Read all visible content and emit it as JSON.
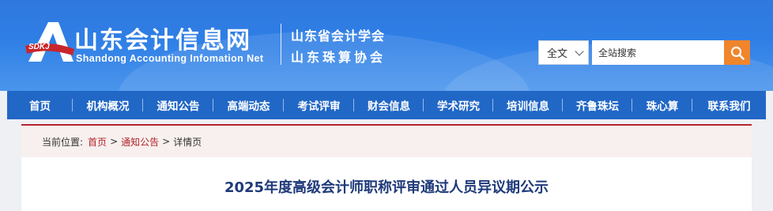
{
  "header": {
    "site_name_cn": "山东会计信息网",
    "site_name_en": "Shandong Accounting Infomation Net",
    "logo_badge": "SDKJ",
    "association_1": "山东省会计学会",
    "association_2": "山东珠算协会",
    "colors": {
      "background": "#2f78de",
      "accent": "#f0852b"
    }
  },
  "search": {
    "scope_selected": "全文",
    "placeholder": "全站搜索",
    "button_icon": "search-icon"
  },
  "nav": {
    "items": [
      {
        "label": "首页"
      },
      {
        "label": "机构概况"
      },
      {
        "label": "通知公告"
      },
      {
        "label": "高端动态"
      },
      {
        "label": "考试评审"
      },
      {
        "label": "财会信息"
      },
      {
        "label": "学术研究"
      },
      {
        "label": "培训信息"
      },
      {
        "label": "齐鲁珠坛"
      },
      {
        "label": "珠心算"
      },
      {
        "label": "联系我们"
      }
    ],
    "color": "#2167c6"
  },
  "breadcrumb": {
    "prefix": "当前位置:",
    "home": "首页",
    "section": "通知公告",
    "current": "详情页",
    "separator": ">",
    "color": "#b3262b"
  },
  "article": {
    "title": "2025年度高级会计师职称评审通过人员异议期公示"
  }
}
